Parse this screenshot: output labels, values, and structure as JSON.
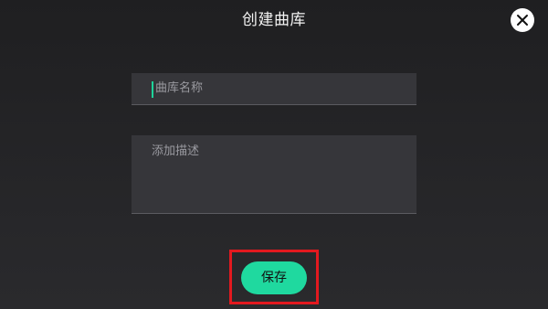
{
  "dialog": {
    "title": "创建曲库",
    "close_icon": "close-icon"
  },
  "form": {
    "name_placeholder": "曲库名称",
    "description_placeholder": "添加描述",
    "save_label": "保存"
  },
  "colors": {
    "accent": "#1fd99f",
    "highlight": "#e3191f",
    "field_bg": "#36363a"
  }
}
